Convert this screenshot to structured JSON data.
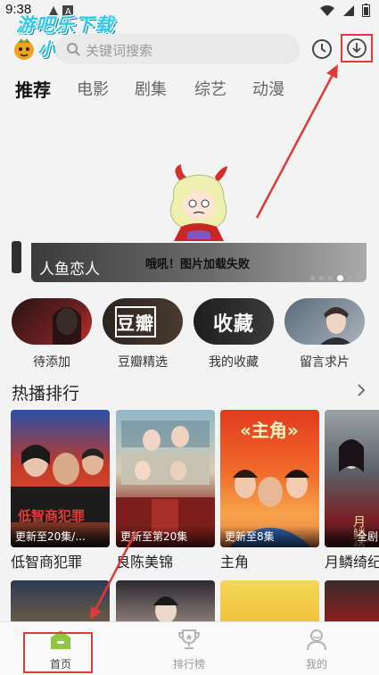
{
  "status_bar": {
    "time": "9:38"
  },
  "watermark": {
    "line1": "游吧乐下载",
    "line2": "小编亲测"
  },
  "search": {
    "placeholder": "关键词搜索"
  },
  "tabs": [
    {
      "label": "推荐",
      "active": true
    },
    {
      "label": "电影",
      "active": false
    },
    {
      "label": "剧集",
      "active": false
    },
    {
      "label": "综艺",
      "active": false
    },
    {
      "label": "动漫",
      "active": false
    }
  ],
  "banner": {
    "title": "人鱼恋人",
    "error_text": "哦吼！图片加载失败"
  },
  "quick_entries": [
    {
      "label": "待添加",
      "image_text": ""
    },
    {
      "label": "豆瓣精选",
      "image_text": "豆瓣"
    },
    {
      "label": "我的收藏",
      "image_text": "收藏"
    },
    {
      "label": "留言求片",
      "image_text": ""
    }
  ],
  "section": {
    "title": "热播排行"
  },
  "posters": [
    {
      "title": "低智商犯罪",
      "badge": "更新至20集/...",
      "art_text": "低智商犯罪"
    },
    {
      "title": "良陈美锦",
      "badge": "更新至第20集",
      "art_text": ""
    },
    {
      "title": "主角",
      "badge": "更新至8集",
      "art_text": "«主角»"
    },
    {
      "title": "月鳞绮纪",
      "badge": "全剧",
      "art_text": "月鳞绮纪"
    }
  ],
  "bottom_nav": [
    {
      "label": "首页",
      "active": true
    },
    {
      "label": "排行榜",
      "active": false
    },
    {
      "label": "我的",
      "active": false
    }
  ],
  "colors": {
    "accent": "#8ec63f",
    "annotation": "#e03a3a",
    "watermark": "#2fc7ee"
  }
}
